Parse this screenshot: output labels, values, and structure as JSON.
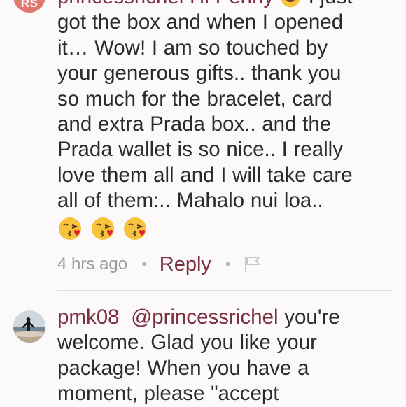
{
  "comment1": {
    "avatar_initials": "RS",
    "partial_first_line": "princessrichel  Hi Penny",
    "partial_first_line_end": "I just",
    "lines": [
      "got the box and when I opened",
      "it… Wow! I am so  touched by",
      "your generous gifts.. thank you",
      "so much for the bracelet, card",
      "and extra Prada box.. and the",
      "Prada wallet is so nice.. I really",
      "love them all and I will take care",
      "all of them:.. Mahalo nui loa.."
    ],
    "emojis": [
      "kissing-face-icon",
      "kissing-face-icon",
      "kissing-face-icon"
    ],
    "time": "4 hrs ago",
    "separator": "•",
    "reply_label": "Reply",
    "flag_icon": "flag-icon"
  },
  "comment2": {
    "username": "pmk08",
    "mention": "@princessrichel",
    "first_line_rest": "you're",
    "lines": [
      "welcome. Glad you like your",
      "package! When you have a",
      "moment, please \"accept"
    ]
  },
  "colors": {
    "accent": "#7a3041",
    "background": "#fbf9fa",
    "avatar_bg": "#e07870",
    "muted": "#9a9a9a"
  }
}
